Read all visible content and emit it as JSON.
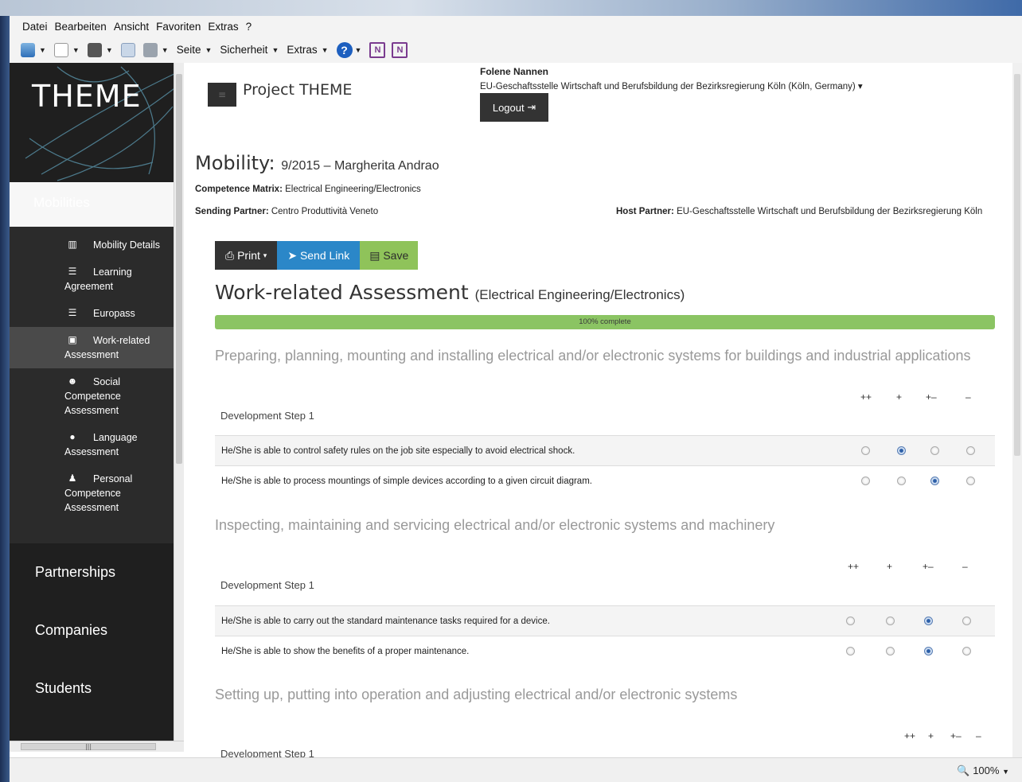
{
  "browser": {
    "menu": [
      "Datei",
      "Bearbeiten",
      "Ansicht",
      "Favoriten",
      "Extras",
      "?"
    ],
    "toolbar": {
      "page": "Seite",
      "security": "Sicherheit",
      "extras": "Extras"
    },
    "zoom": "100%"
  },
  "sidebar": {
    "logo": "THEME",
    "section": "Mobilities",
    "subitems": [
      {
        "label": "Mobility Details",
        "icon": "bank-icon"
      },
      {
        "label": "Learning Agreement",
        "icon": "list-icon"
      },
      {
        "label": "Europass",
        "icon": "list-icon"
      },
      {
        "label": "Work-related Assessment",
        "icon": "briefcase-icon"
      },
      {
        "label": "Social Competence Assessment",
        "icon": "users-icon"
      },
      {
        "label": "Language Assessment",
        "icon": "globe-icon"
      },
      {
        "label": "Personal Competence Assessment",
        "icon": "user-icon"
      }
    ],
    "main": [
      "Partnerships",
      "Companies",
      "Students"
    ]
  },
  "header": {
    "project": "Project THEME",
    "user_name": "Folene Nannen",
    "user_org": "EU-Geschaftsstelle Wirtschaft und Berufsbildung der Bezirksregierung Köln (Köln, Germany)",
    "logout": "Logout"
  },
  "mobility": {
    "title": "Mobility:",
    "subtitle": "9/2015 – Margherita Andrao",
    "matrix_label": "Competence Matrix:",
    "matrix_value": "Electrical Engineering/Electronics",
    "sending_label": "Sending Partner:",
    "sending_value": "Centro Produttività Veneto",
    "host_label": "Host Partner:",
    "host_value": "EU-Geschaftsstelle Wirtschaft und Berufsbildung der Bezirksregierung Köln"
  },
  "actions": {
    "print": "Print",
    "send": "Send Link",
    "save": "Save"
  },
  "assessment": {
    "title": "Work-related Assessment",
    "subtitle": "(Electrical Engineering/Electronics)",
    "progress_text": "100% complete",
    "progress": 100,
    "scale": [
      "++",
      "+",
      "+–",
      "–"
    ],
    "sections": [
      {
        "title": "Preparing, planning, mounting and installing electrical and/or electronic systems for buildings and industrial applications",
        "step": "Development Step 1",
        "items": [
          {
            "text": "He/She is able to control safety rules on the job site especially to avoid electrical shock.",
            "selected": 1
          },
          {
            "text": "He/She is able to process mountings of simple devices according to a given circuit diagram.",
            "selected": 2
          }
        ]
      },
      {
        "title": "Inspecting, maintaining and servicing electrical and/or electronic systems and machinery",
        "step": "Development Step 1",
        "items": [
          {
            "text": "He/She is able to carry out the standard maintenance tasks required for a device.",
            "selected": 2
          },
          {
            "text": "He/She is able to show the benefits of a proper maintenance.",
            "selected": 2
          }
        ]
      },
      {
        "title": "Setting up, putting into operation and adjusting electrical and/or electronic systems",
        "step": "Development Step 1",
        "items": []
      }
    ]
  }
}
